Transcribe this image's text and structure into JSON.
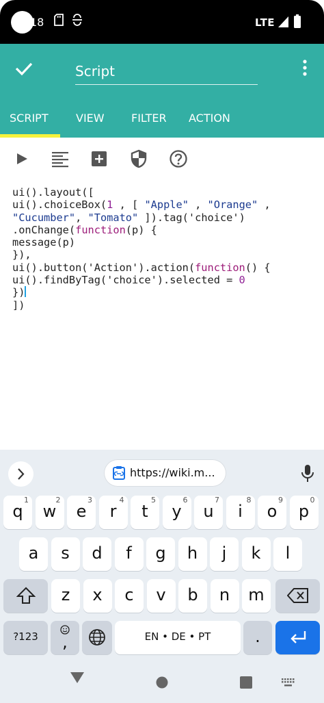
{
  "status": {
    "time": "18",
    "network": "LTE"
  },
  "appbar": {
    "title": "Script"
  },
  "tabs": [
    {
      "label": "SCRIPT",
      "active": true
    },
    {
      "label": "VIEW",
      "active": false
    },
    {
      "label": "FILTER",
      "active": false
    },
    {
      "label": "ACTION",
      "active": false
    }
  ],
  "toolbar": {
    "icons": [
      "play-icon",
      "format-icon",
      "add-box-icon",
      "shield-icon",
      "help-icon"
    ]
  },
  "code": {
    "line1": "ui().layout([",
    "line2_pre": "ui().choiceBox(",
    "line2_num": "1",
    "line2_mid": " , [ ",
    "str_apple": "\"Apple\"",
    "sep1": " , ",
    "str_orange": "\"Orange\"",
    "sep2": " ,",
    "str_cucumber": "\"Cucumber\"",
    "sep3": ", ",
    "str_tomato": "\"Tomato\"",
    "line3_post": " ]).tag('choice')",
    "line4_pre": ".onChange(",
    "line4_kw": "function",
    "line4_post": "(p) {",
    "line5": "message(p)",
    "line6": "}),",
    "line7_pre": "ui().button('Action').action(",
    "line7_kw": "function",
    "line7_post": "() {",
    "line8_pre": "ui().findByTag('choice').selected = ",
    "line8_num": "0",
    "line9": "})",
    "line10": "])"
  },
  "keyboard": {
    "suggestion_url": "https://wiki.m...",
    "row1": [
      {
        "k": "q",
        "h": "1"
      },
      {
        "k": "w",
        "h": "2"
      },
      {
        "k": "e",
        "h": "3"
      },
      {
        "k": "r",
        "h": "4"
      },
      {
        "k": "t",
        "h": "5"
      },
      {
        "k": "y",
        "h": "6"
      },
      {
        "k": "u",
        "h": "7"
      },
      {
        "k": "i",
        "h": "8"
      },
      {
        "k": "o",
        "h": "9"
      },
      {
        "k": "p",
        "h": "0"
      }
    ],
    "row2": [
      "a",
      "s",
      "d",
      "f",
      "g",
      "h",
      "j",
      "k",
      "l"
    ],
    "row3": [
      "z",
      "x",
      "c",
      "v",
      "b",
      "n",
      "m"
    ],
    "symbols_label": "?123",
    "emoji_comma": ",",
    "space_label": "EN • DE • PT",
    "period": "."
  },
  "colors": {
    "appbar": "#33AFA4",
    "tab_indicator": "#F5F23C",
    "enter_key": "#1A73E8"
  }
}
